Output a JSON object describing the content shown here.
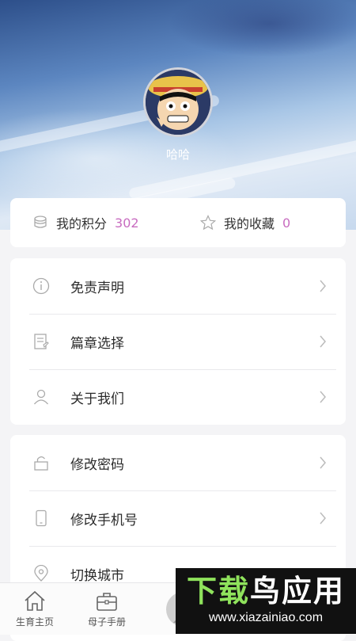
{
  "profile": {
    "username": "哈哈"
  },
  "stats": [
    {
      "label": "我的积分",
      "value": "302",
      "icon": "coins-stack-icon"
    },
    {
      "label": "我的收藏",
      "value": "0",
      "icon": "star-icon"
    }
  ],
  "menu_group_1": [
    {
      "label": "免责声明",
      "icon": "info-circle-icon"
    },
    {
      "label": "篇章选择",
      "icon": "document-edit-icon"
    },
    {
      "label": "关于我们",
      "icon": "person-icon"
    }
  ],
  "menu_group_2": [
    {
      "label": "修改密码",
      "icon": "lock-icon"
    },
    {
      "label": "修改手机号",
      "icon": "phone-icon"
    },
    {
      "label": "切换城市",
      "icon": "location-pin-icon"
    }
  ],
  "tabbar": [
    {
      "label": "生育主页",
      "icon": "home-icon"
    },
    {
      "label": "母子手册",
      "icon": "briefcase-icon"
    }
  ],
  "watermark": {
    "title_a": "下载",
    "title_b": "鸟应用",
    "url": "www.xiazainiao.com"
  },
  "colors": {
    "accent_number": "#c86cc0",
    "watermark_green": "#8fe35c"
  }
}
